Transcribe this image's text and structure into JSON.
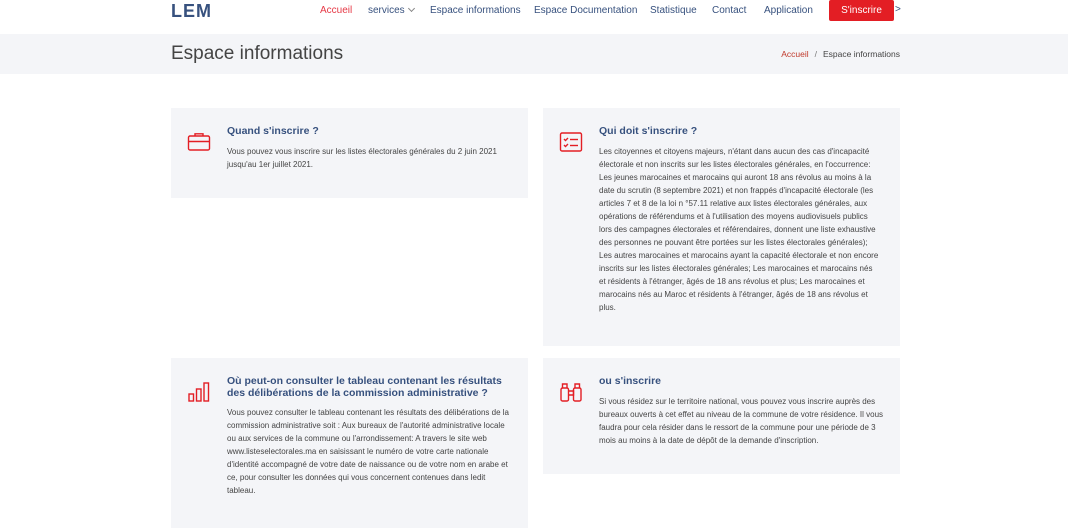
{
  "header": {
    "logo": "LEM",
    "nav": [
      {
        "label": "Accueil",
        "active": true
      },
      {
        "label": "services",
        "dropdown": true
      },
      {
        "label": "Espace informations"
      },
      {
        "label": "Espace Documentation"
      },
      {
        "label": "Statistique"
      },
      {
        "label": "Contact"
      },
      {
        "label": "Application"
      }
    ],
    "cta_label": "S'inscrire",
    "cta_arrow": ">"
  },
  "band": {
    "title": "Espace informations",
    "breadcrumb_home": "Accueil",
    "breadcrumb_sep": "/",
    "breadcrumb_current": "Espace informations"
  },
  "cards": [
    {
      "icon": "briefcase-icon",
      "title": "Quand s'inscrire ?",
      "text": "Vous pouvez vous inscrire sur les listes électorales générales du 2 juin 2021 jusqu'au 1er juillet 2021."
    },
    {
      "icon": "checklist-icon",
      "title": "Qui doit s'inscrire ?",
      "text": "Les citoyennes et citoyens majeurs, n'étant dans aucun des cas d'incapacité électorale et non inscrits sur les listes électorales générales, en l'occurrence: Les jeunes marocaines et marocains qui auront 18 ans révolus au moins à la date du scrutin (8 septembre 2021) et non frappés d'incapacité électorale (les articles 7 et 8 de la loi n °57.11 relative aux listes électorales générales, aux opérations de référendums et à l'utilisation des moyens audiovisuels publics lors des campagnes électorales et référendaires, donnent une liste exhaustive des personnes ne pouvant être portées sur les listes électorales générales); Les autres marocaines et marocains ayant la capacité électorale et non encore inscrits sur les listes électorales générales; Les marocaines et marocains nés et résidents à l'étranger, âgés de 18 ans révolus et plus; Les marocaines et marocains nés au Maroc et résidents à l'étranger, âgés de 18 ans révolus et plus."
    },
    {
      "icon": "bar-chart-icon",
      "title": "Où peut-on consulter le tableau contenant les résultats des délibérations de la commission administrative ?",
      "text": "Vous pouvez consulter le tableau contenant les résultats des délibérations de la commission administrative soit : Aux bureaux de l'autorité administrative locale ou aux services de la commune ou l'arrondissement: A travers le site web www.listeselectorales.ma en saisissant le numéro de votre carte nationale d'identité accompagné de votre date de naissance ou de votre nom en arabe et ce, pour consulter les données qui vous concernent contenues dans ledit tableau."
    },
    {
      "icon": "binoculars-icon",
      "title": "ou s'inscrire",
      "text": "Si vous résidez sur le territoire national, vous pouvez vous inscrire auprès des bureaux ouverts à cet effet au niveau de la commune de votre résidence. Il vous faudra pour cela résider dans le ressort de la commune pour une période de 3 mois au moins à la date de dépôt de la demande d'inscription."
    }
  ],
  "colors": {
    "accent": "#e31e24",
    "nav_text": "#37517e",
    "card_bg": "#f4f5f8"
  }
}
